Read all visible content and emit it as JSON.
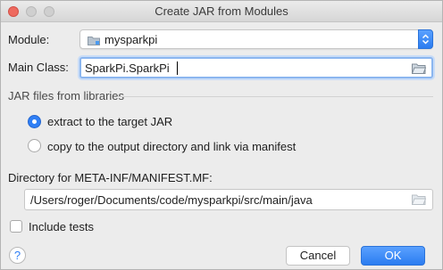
{
  "window": {
    "title": "Create JAR from Modules"
  },
  "module": {
    "label": "Module:",
    "value": "mysparkpi"
  },
  "main_class": {
    "label": "Main Class:",
    "value": "SparkPi.SparkPi"
  },
  "libraries": {
    "section_label": "JAR files from libraries",
    "options": [
      {
        "label": "extract to the target JAR",
        "selected": true
      },
      {
        "label": "copy to the output directory and link via manifest",
        "selected": false
      }
    ]
  },
  "manifest": {
    "label": "Directory for META-INF/MANIFEST.MF:",
    "value": "/Users/roger/Documents/code/mysparkpi/src/main/java"
  },
  "include_tests": {
    "label": "Include tests",
    "checked": false
  },
  "buttons": {
    "help": "?",
    "cancel": "Cancel",
    "ok": "OK"
  },
  "colors": {
    "accent": "#2f7ff5",
    "close": "#ee6a5f"
  }
}
